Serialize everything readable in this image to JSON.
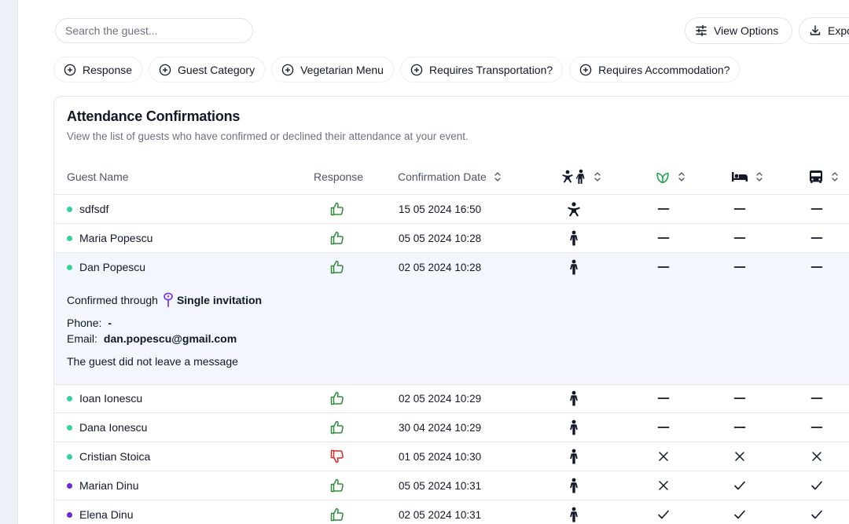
{
  "search": {
    "placeholder": "Search the guest..."
  },
  "toolbar": {
    "view_options": "View Options",
    "export": "Export"
  },
  "filters": [
    "Response",
    "Guest Category",
    "Vegetarian Menu",
    "Requires Transportation?",
    "Requires Accommodation?"
  ],
  "card": {
    "title": "Attendance Confirmations",
    "subtitle": "View the list of guests who have confirmed or declined their attendance at your event."
  },
  "columns": {
    "guest_name": "Guest Name",
    "response": "Response",
    "confirmation_date": "Confirmation Date",
    "category_icon": "child-adult-icon",
    "vegetarian_icon": "leaf-icon",
    "accommodation_icon": "bed-icon",
    "transportation_icon": "bus-icon"
  },
  "colors": {
    "accent_purple": "#7c3aed",
    "status_green": "#34d399",
    "status_purple": "#6d28d9",
    "thumb_up": "#2f8a3b",
    "thumb_down": "#dc2626"
  },
  "rows": [
    {
      "name": "sdfsdf",
      "status": "green",
      "response": "yes",
      "date": "15 05 2024 16:50",
      "category": "child",
      "vegetarian": "none",
      "accommodation": "none",
      "transportation": "none"
    },
    {
      "name": "Maria Popescu",
      "status": "green",
      "response": "yes",
      "date": "05 05 2024 10:28",
      "category": "adult",
      "vegetarian": "none",
      "accommodation": "none",
      "transportation": "none"
    },
    {
      "name": "Dan Popescu",
      "status": "green",
      "response": "yes",
      "date": "02 05 2024 10:28",
      "category": "adult",
      "vegetarian": "none",
      "accommodation": "none",
      "transportation": "none"
    },
    {
      "name": "Ioan Ionescu",
      "status": "green",
      "response": "yes",
      "date": "02 05 2024 10:29",
      "category": "adult",
      "vegetarian": "none",
      "accommodation": "none",
      "transportation": "none"
    },
    {
      "name": "Dana Ionescu",
      "status": "green",
      "response": "yes",
      "date": "30 04 2024 10:29",
      "category": "adult",
      "vegetarian": "none",
      "accommodation": "none",
      "transportation": "none"
    },
    {
      "name": "Cristian Stoica",
      "status": "green",
      "response": "no",
      "date": "01 05 2024 10:30",
      "category": "adult",
      "vegetarian": "no",
      "accommodation": "no",
      "transportation": "no"
    },
    {
      "name": "Marian Dinu",
      "status": "purple",
      "response": "yes",
      "date": "05 05 2024 10:31",
      "category": "adult",
      "vegetarian": "no",
      "accommodation": "yes",
      "transportation": "yes"
    },
    {
      "name": "Elena Dinu",
      "status": "purple",
      "response": "yes",
      "date": "02 05 2024 10:31",
      "category": "adult",
      "vegetarian": "yes",
      "accommodation": "yes",
      "transportation": "yes"
    }
  ],
  "expanded": {
    "confirmed_through_label": "Confirmed through",
    "confirmed_through_value": "Single invitation",
    "phone_label": "Phone:",
    "phone_value": "-",
    "email_label": "Email:",
    "email_value": "dan.popescu@gmail.com",
    "message": "The guest did not leave a message"
  }
}
